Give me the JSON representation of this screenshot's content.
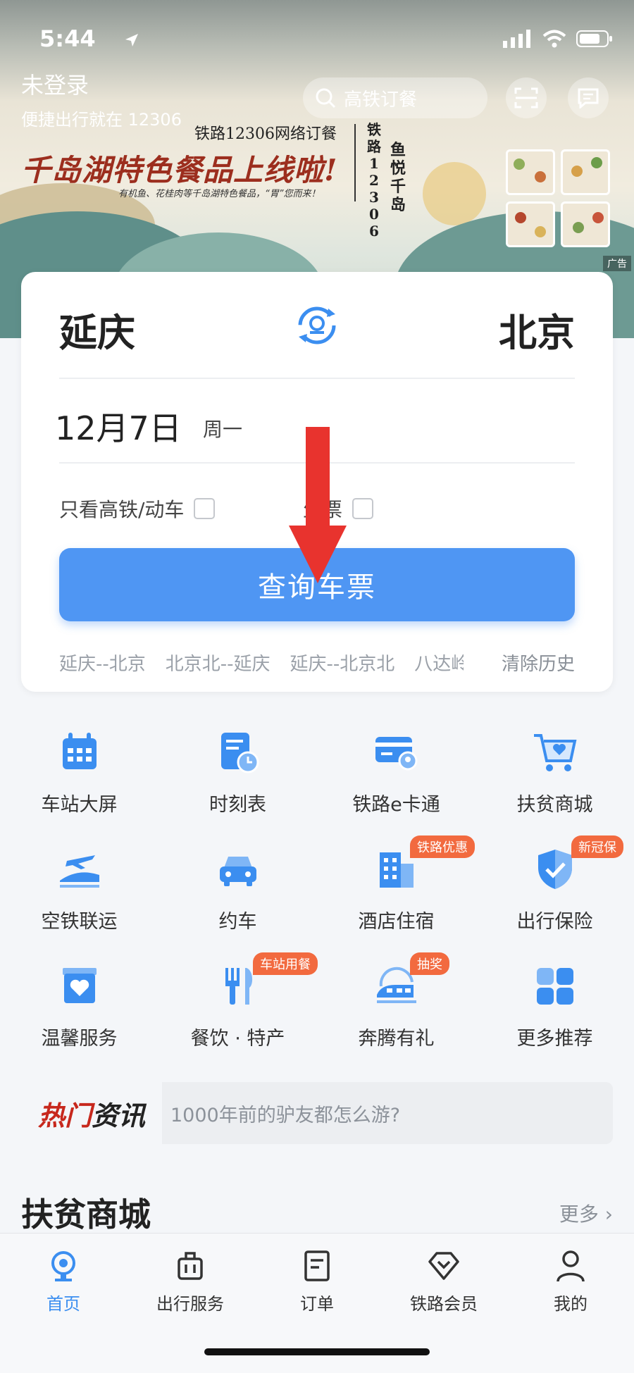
{
  "status_bar": {
    "time": "5:44"
  },
  "header": {
    "login_title": "未登录",
    "login_subtitle": "便捷出行就在 12306",
    "search_placeholder": "高铁订餐"
  },
  "banner": {
    "subtitle": "铁路12306网络订餐",
    "title": "千岛湖特色餐品上线啦!",
    "small_text": "有机鱼、花桂肉等千岛湖特色餐品，“胃”您而来！",
    "vertical_1": "铁路12306",
    "vertical_2": "鱼悦千岛",
    "ad_label": "广告"
  },
  "ticket": {
    "from_city": "延庆",
    "to_city": "北京",
    "date": "12月7日",
    "weekday": "周一",
    "option_highspeed": "只看高铁/动车",
    "option_student": "生票",
    "search_button": "查询车票",
    "history": [
      "延庆--北京",
      "北京北--延庆",
      "延庆--北京北",
      "八达岭"
    ],
    "clear_history": "清除历史"
  },
  "services": [
    {
      "label": "车站大屏",
      "icon": "calendar-icon"
    },
    {
      "label": "时刻表",
      "icon": "timetable-icon"
    },
    {
      "label": "铁路e卡通",
      "icon": "card-icon"
    },
    {
      "label": "扶贫商城",
      "icon": "cart-heart-icon"
    },
    {
      "label": "空铁联运",
      "icon": "plane-train-icon"
    },
    {
      "label": "约车",
      "icon": "car-icon"
    },
    {
      "label": "酒店住宿",
      "icon": "hotel-icon",
      "tag": "铁路优惠"
    },
    {
      "label": "出行保险",
      "icon": "shield-icon",
      "tag": "新冠保"
    },
    {
      "label": "温馨服务",
      "icon": "heart-box-icon"
    },
    {
      "label": "餐饮 · 特产",
      "icon": "fork-knife-icon",
      "tag": "车站用餐"
    },
    {
      "label": "奔腾有礼",
      "icon": "train-gift-icon",
      "tag": "抽奖"
    },
    {
      "label": "更多推荐",
      "icon": "grid-icon"
    }
  ],
  "news": {
    "head_1": "热门",
    "head_2": "资讯",
    "text": "1000年前的驴友都怎么游?"
  },
  "section": {
    "title": "扶贫商城",
    "more": "更多 ›"
  },
  "tabs": [
    {
      "label": "首页",
      "icon": "home-train-icon",
      "active": true
    },
    {
      "label": "出行服务",
      "icon": "luggage-icon"
    },
    {
      "label": "订单",
      "icon": "order-icon"
    },
    {
      "label": "铁路会员",
      "icon": "diamond-icon"
    },
    {
      "label": "我的",
      "icon": "user-icon"
    }
  ],
  "colors": {
    "primary": "#4f96f3",
    "tag": "#f26a3f",
    "arrow": "#e8332e"
  }
}
